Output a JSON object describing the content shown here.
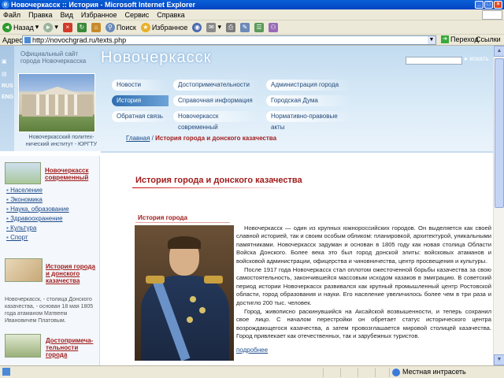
{
  "window": {
    "title": "Новочеркасск :: История - Microsoft Internet Explorer"
  },
  "menu": [
    "Файл",
    "Правка",
    "Вид",
    "Избранное",
    "Сервис",
    "Справка"
  ],
  "toolbar": {
    "back": "Назад",
    "search": "Поиск",
    "favorites": "Избранное"
  },
  "address": {
    "label": "Адрес:",
    "url": "http://novochgrad.ru/texts.php",
    "go": "Переход",
    "links": "Ссылки"
  },
  "status": {
    "zone": "Местная интрасеть"
  },
  "page": {
    "lang": [
      "RUS",
      "ENG"
    ],
    "site_sub": "Официальный сайт города Новочеркасска",
    "site_title": "Новочеркасск",
    "search_label": "искать",
    "caption": "Новочеркасский политех-нический институт - ЮРГТУ",
    "nav": [
      {
        "label": "Новости"
      },
      {
        "label": "Достопримечательности"
      },
      {
        "label": "Администрация города"
      },
      {
        "label": "История"
      },
      {
        "label": "Справочная информация"
      },
      {
        "label": "Городская Дума"
      },
      {
        "label": "Обратная связь"
      },
      {
        "label": "Новочеркасск современный"
      },
      {
        "label": "Нормативно-правовые акты"
      }
    ],
    "breadcrumb": {
      "home": "Главная",
      "sep": " / ",
      "current": "История города и донского казачества"
    },
    "sidebar": {
      "modern_title": "Новочеркасск современный",
      "list": [
        "Население",
        "Экономика",
        "Наука, образование",
        "Здравоохранение",
        "Культура",
        "Спорт"
      ],
      "history_title": "История города и донского казачества",
      "history_text": "Новочеркасск, - столица Донского казачества, - основан 18 мая 1805 года атаманом Матвеем Ивановичем Платовым.",
      "sights_title": "Достопримеча-тельности города"
    },
    "heading": "История города и донского казачества",
    "subheading": "История города",
    "paragraphs": [
      "Новочеркасск — один из крупных южнороссийских городов. Он выделяется как своей славной историей, так и своим особым обликом: планировкой, архитектурой, уникальными памятниками. Новочеркасск задуман и основан в 1805 году как новая столица Области Войска Донского. Более века это был город донской элиты: войсковых атаманов и войсковой администрации, офицерства и чиновничества, центр просвещения и культуры.",
      "После 1917 года Новочеркасск стал оплотом ожесточенной борьбы казачества за свою самостоятельность, закончившейся массовым исходом казаков в эмиграцию. В советский период истории Новочеркасск развивался как крупный промышленный центр Ростовской области, город образования и науки. Его население увеличилось более чем в три раза и достигло 200 тыс. человек.",
      "Город, живописно раскинувшийся на Аксайской возвышенности, и теперь сохранил свое лицо. С началом перестройки он обретает статус исторического центра возрождающегося казачества, а затем провозглашается мировой столицей казачества. Город привлекает как отечественных, так и зарубежных туристов."
    ],
    "more": "подробнее"
  }
}
